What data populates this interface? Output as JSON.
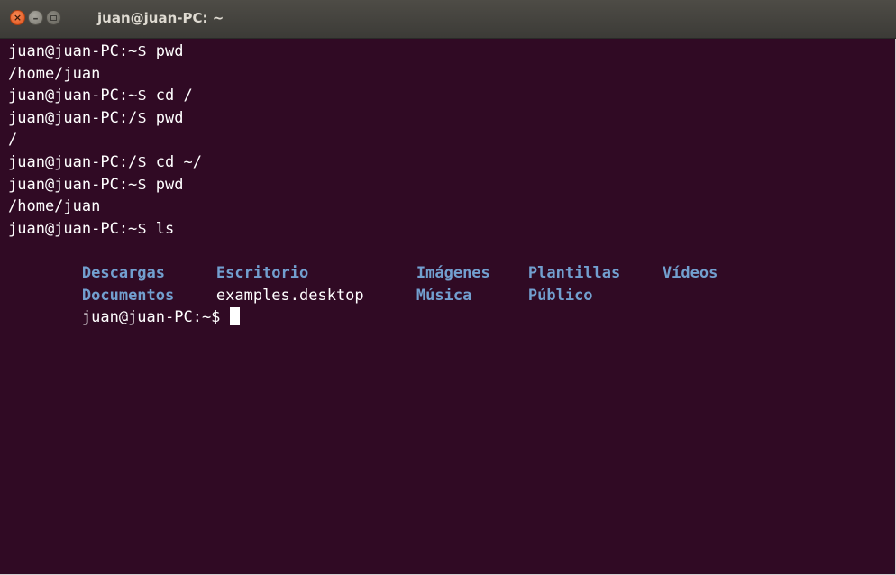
{
  "window": {
    "title": "juan@juan-PC: ~",
    "close_glyph": "×",
    "minimize_glyph": "–"
  },
  "terminal": {
    "background": "#300a24",
    "foreground": "#ffffff",
    "directory_color": "#729fcf",
    "lines": [
      "juan@juan-PC:~$ pwd",
      "/home/juan",
      "juan@juan-PC:~$ cd /",
      "juan@juan-PC:/$ pwd",
      "/",
      "juan@juan-PC:/$ cd ~/",
      "juan@juan-PC:~$ pwd",
      "/home/juan",
      "juan@juan-PC:~$ ls"
    ],
    "ls_output": {
      "row1": [
        "Descargas",
        "Escritorio",
        "Imágenes",
        "Plantillas",
        "Vídeos"
      ],
      "row2": [
        "Documentos",
        "examples.desktop",
        "Música",
        "Público"
      ]
    },
    "prompt": "juan@juan-PC:~$ "
  }
}
